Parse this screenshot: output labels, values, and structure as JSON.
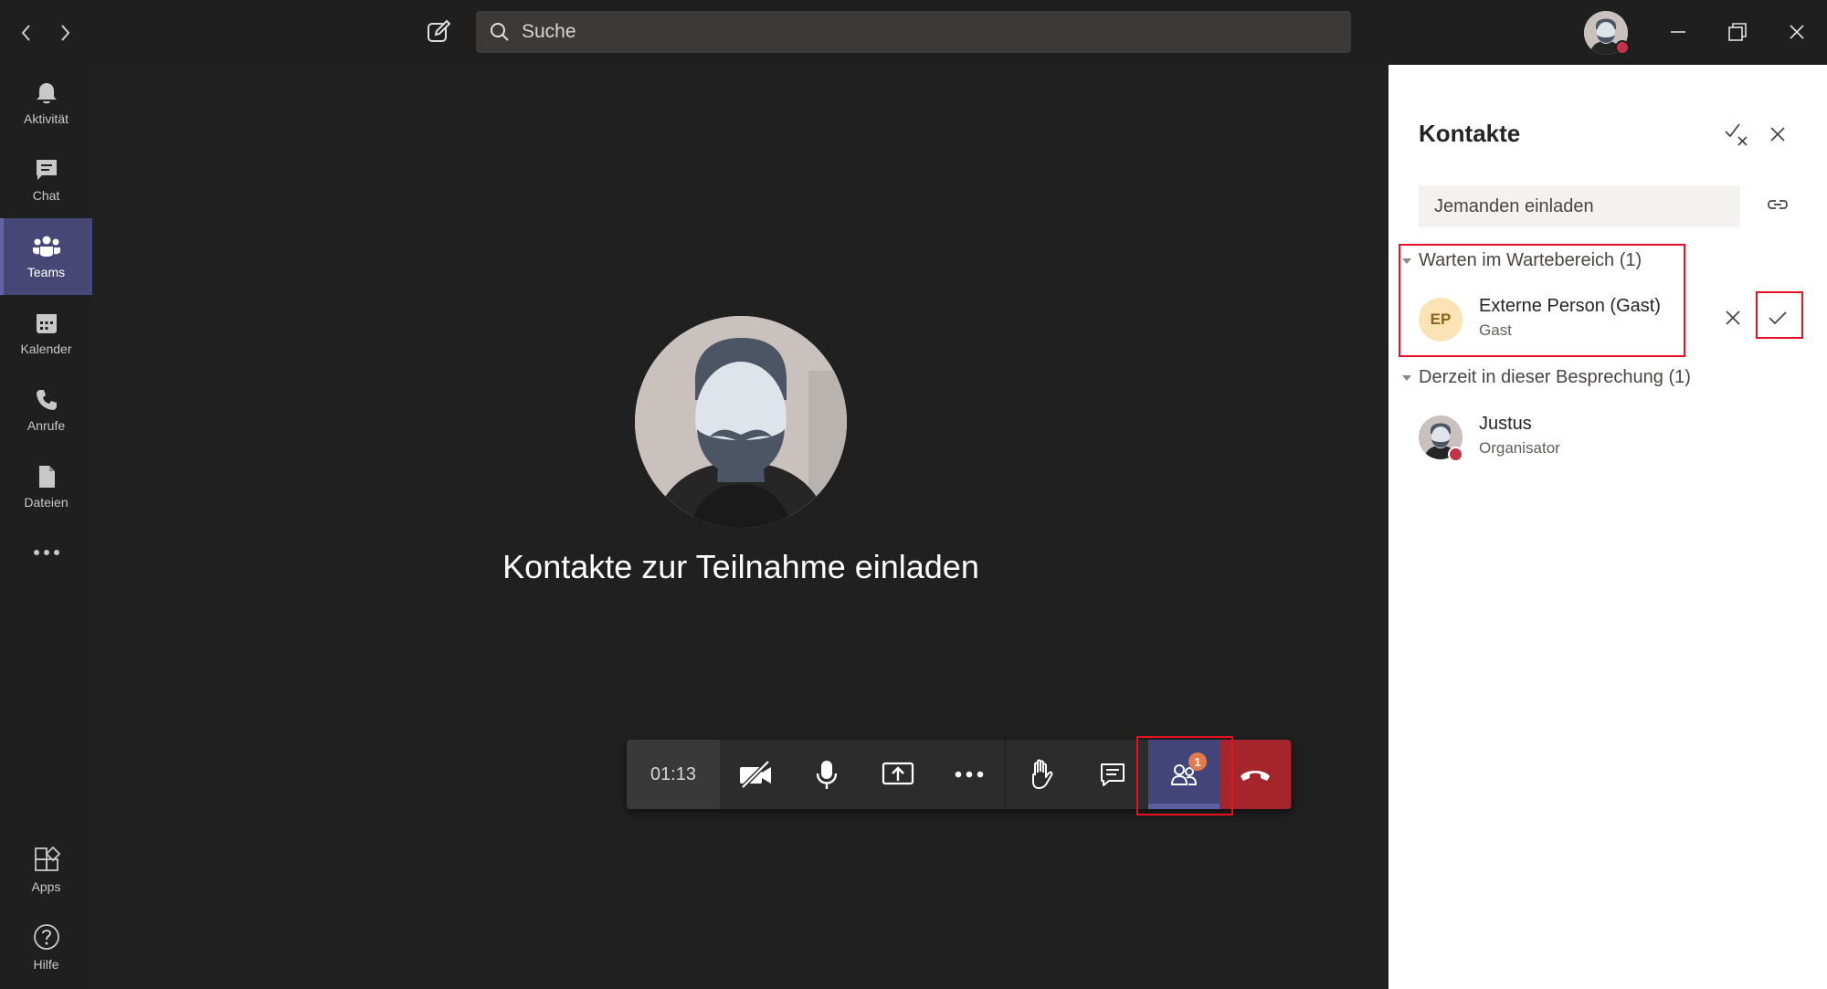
{
  "titlebar": {
    "back_icon": "chevron-left-icon",
    "forward_icon": "chevron-right-icon",
    "compose_icon": "compose-icon",
    "search": {
      "placeholder": "Suche"
    }
  },
  "rail": {
    "items": [
      {
        "label": "Aktivität",
        "icon": "bell-icon"
      },
      {
        "label": "Chat",
        "icon": "chat-icon"
      },
      {
        "label": "Teams",
        "icon": "teams-icon",
        "active": true
      },
      {
        "label": "Kalender",
        "icon": "calendar-icon"
      },
      {
        "label": "Anrufe",
        "icon": "phone-icon"
      },
      {
        "label": "Dateien",
        "icon": "file-icon"
      }
    ],
    "bottom": [
      {
        "label": "Apps",
        "icon": "apps-icon"
      },
      {
        "label": "Hilfe",
        "icon": "help-icon"
      }
    ]
  },
  "stage": {
    "message": "Kontakte zur Teilnahme einladen"
  },
  "callbar": {
    "timer": "01:13",
    "participants_badge": "1"
  },
  "panel": {
    "title": "Kontakte",
    "invite_placeholder": "Jemanden einladen",
    "waiting": {
      "header": "Warten im Wartebereich (1)",
      "person": {
        "initials": "EP",
        "name": "Externe Person (Gast)",
        "role": "Gast"
      }
    },
    "in_meeting": {
      "header": "Derzeit in dieser Besprechung (1)",
      "person": {
        "name": "Justus",
        "role": "Organisator"
      }
    }
  },
  "colors": {
    "accent": "#6264a7",
    "hangup": "#a4262c",
    "badge": "#e37a4c",
    "highlight": "#e81123",
    "presence_busy": "#c4314b"
  }
}
